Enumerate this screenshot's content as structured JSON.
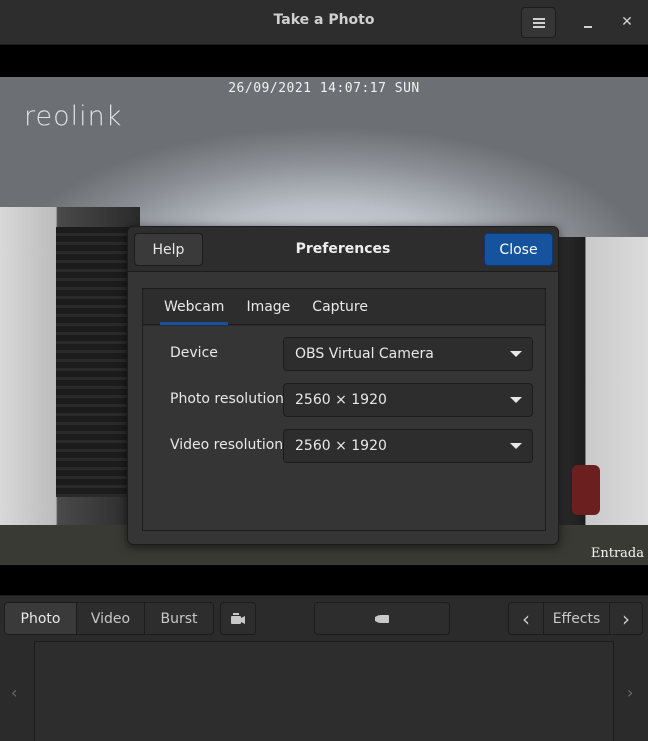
{
  "window": {
    "title": "Take a Photo",
    "menu_icon": "hamburger-menu-icon",
    "minimize_icon": "minimize-icon",
    "close_glyph": "✕"
  },
  "camera": {
    "timestamp": "26/09/2021 14:07:17 SUN",
    "logo": "reolink",
    "location_label": "Entrada"
  },
  "preferences": {
    "title": "Preferences",
    "help_label": "Help",
    "close_label": "Close",
    "accent_color": "#15539e",
    "tabs": [
      {
        "label": "Webcam",
        "active": true
      },
      {
        "label": "Image",
        "active": false
      },
      {
        "label": "Capture",
        "active": false
      }
    ],
    "rows": [
      {
        "label": "Device",
        "value": "OBS Virtual Camera"
      },
      {
        "label": "Photo resolution",
        "value": "2560 × 1920"
      },
      {
        "label": "Video resolution",
        "value": "2560 × 1920"
      }
    ]
  },
  "toolbar": {
    "modes": [
      {
        "label": "Photo",
        "active": true
      },
      {
        "label": "Video",
        "active": false
      },
      {
        "label": "Burst",
        "active": false
      }
    ],
    "switch_camera_icon": "switch-camera-icon",
    "shoot_icon": "camera-shoot-icon",
    "effects_label": "Effects",
    "effects_prev_glyph": "‹",
    "effects_next_glyph": "›"
  },
  "thumbnails": {
    "prev_glyph": "‹",
    "next_glyph": "›"
  }
}
